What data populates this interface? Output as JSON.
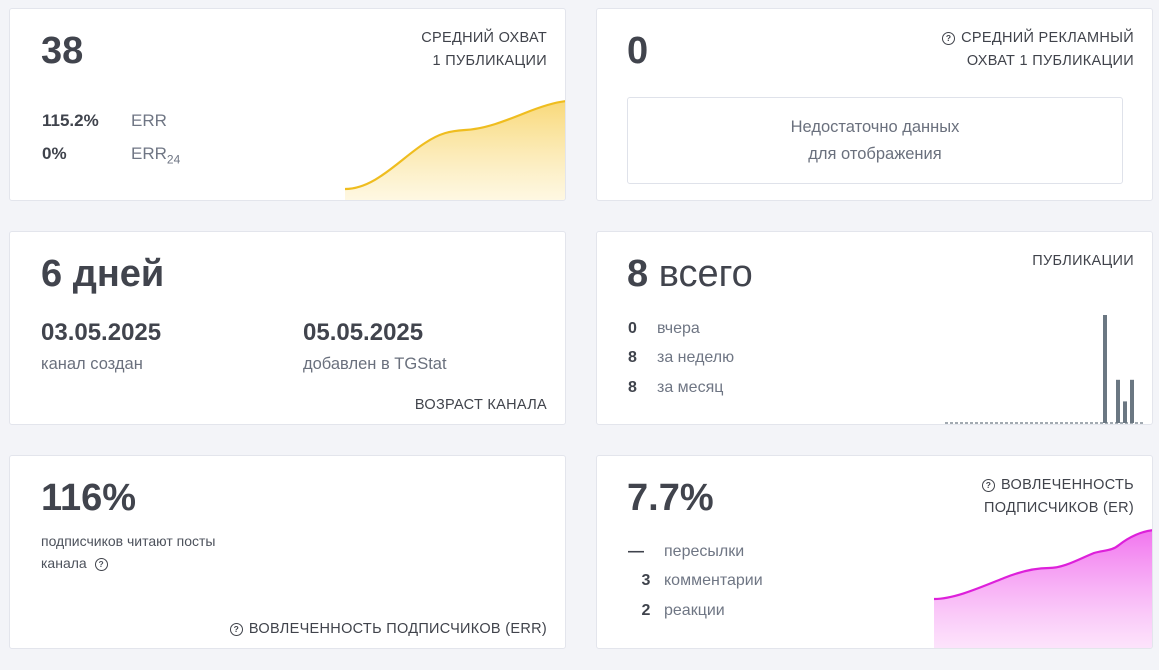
{
  "card1": {
    "value": "38",
    "caption_line1": "СРЕДНИЙ ОХВАТ",
    "caption_line2": "1 ПУБЛИКАЦИИ",
    "err_value": "115.2%",
    "err_label": "ERR",
    "err24_value": "0%",
    "err24_label": "ERR",
    "err24_sub": "24",
    "chart_color": "#f2c12e"
  },
  "card2": {
    "value": "0",
    "caption_line1": "СРЕДНИЙ РЕКЛАМНЫЙ",
    "caption_line2": "ОХВАТ 1 ПУБЛИКАЦИИ",
    "nodata_line1": "Недостаточно данных",
    "nodata_line2": "для отображения"
  },
  "card3": {
    "value": "6 дней",
    "created_date": "03.05.2025",
    "created_label": "канал создан",
    "added_date": "05.05.2025",
    "added_label": "добавлен в TGStat",
    "caption": "ВОЗРАСТ КАНАЛА"
  },
  "card4": {
    "value_num": "8",
    "value_word": "всего",
    "caption": "ПУБЛИКАЦИИ",
    "rows": [
      {
        "num": "0",
        "label": "вчера"
      },
      {
        "num": "8",
        "label": "за неделю"
      },
      {
        "num": "8",
        "label": "за месяц"
      }
    ],
    "bar_color": "#6b7782",
    "bar_values": [
      5,
      2,
      1,
      2
    ]
  },
  "card5": {
    "value": "116%",
    "desc_line1": "подписчиков читают посты",
    "desc_line2": "канала",
    "caption": "ВОВЛЕЧЕННОСТЬ ПОДПИСЧИКОВ (ERR)"
  },
  "card6": {
    "value": "7.7%",
    "caption_line1": "ВОВЛЕЧЕННОСТЬ",
    "caption_line2": "ПОДПИСЧИКОВ (ER)",
    "rows": [
      {
        "num": "—",
        "label": "пересылки"
      },
      {
        "num": "3",
        "label": "комментарии"
      },
      {
        "num": "2",
        "label": "реакции"
      }
    ],
    "chart_color": "#e22fe0"
  }
}
